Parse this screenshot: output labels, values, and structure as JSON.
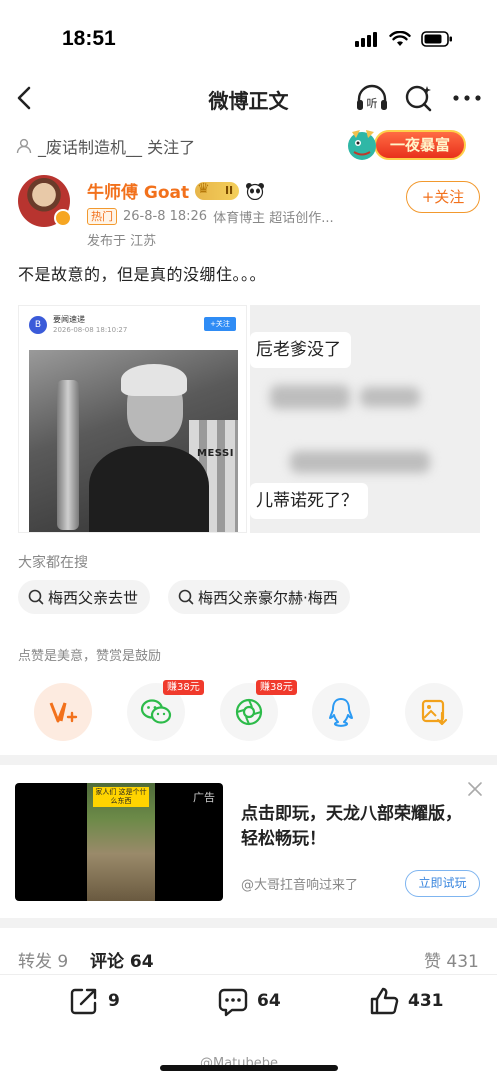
{
  "status_bar": {
    "time": "18:51"
  },
  "nav": {
    "title": "微博正文"
  },
  "follow_notice": {
    "text": "_废话制造机__ 关注了"
  },
  "promo": {
    "text": "一夜暴富"
  },
  "author": {
    "name": "牛师傅 Goat",
    "level": "II",
    "hot_tag": "热门",
    "date": "26-8-8 18:26",
    "descriptor": "体育博主 超话创作...",
    "location": "发布于 江苏",
    "follow_label": "+关注"
  },
  "post": {
    "text": "不是故意的，但是真的没绷住。。。"
  },
  "image_left": {
    "source": "要闻速递",
    "date": "2026-08-08 18:10:27",
    "follow": "+关注",
    "jersey": "MESSI"
  },
  "image_right": {
    "line1": "卮老爹没了",
    "line2": "儿蒂诺死了？"
  },
  "search_section": {
    "label": "大家都在搜",
    "chips": [
      "梅西父亲去世",
      "梅西父亲豪尔赫·梅西"
    ]
  },
  "reward_section": {
    "label": "点赞是美意，赞赏是鼓励",
    "bonus_1": "赚38元",
    "bonus_2": "赚38元"
  },
  "ad": {
    "label": "广告",
    "video_caption": "家人们 这是个什么东西",
    "title": "点击即玩，天龙八部荣耀版，轻松畅玩！",
    "account": "@大哥扛音响过来了",
    "button": "立即试玩"
  },
  "tabs": {
    "repost": "转发 9",
    "comment": "评论 64",
    "like": "赞 431"
  },
  "bottom_bar": {
    "repost_count": "9",
    "comment_count": "64",
    "like_count": "431"
  },
  "watermark": "@Matubebe",
  "colors": {
    "accent_orange": "#f2711c",
    "link_blue": "#3a86de",
    "bonus_red": "#f03a2c"
  }
}
